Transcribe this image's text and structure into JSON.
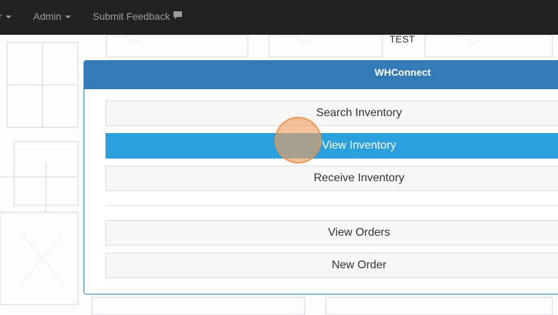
{
  "navbar": {
    "items": [
      {
        "label": "r",
        "has_caret": true
      },
      {
        "label": "Admin",
        "has_caret": true
      },
      {
        "label": "Submit Feedback",
        "icon": "comment-icon"
      }
    ]
  },
  "environment_label": "TEST",
  "panel": {
    "title": "WHConnect",
    "buttons": [
      {
        "label": "Search Inventory",
        "state": "default"
      },
      {
        "label": "View Inventory",
        "state": "active"
      },
      {
        "label": "Receive Inventory",
        "state": "default"
      },
      {
        "label": "View Orders",
        "state": "default"
      },
      {
        "label": "New Order",
        "state": "default"
      }
    ]
  },
  "colors": {
    "navbar_bg": "#222222",
    "nav_text": "#9d9d9d",
    "panel_primary": "#337ab7",
    "active_button": "#2aa1dd",
    "click_marker": "#eca064"
  }
}
